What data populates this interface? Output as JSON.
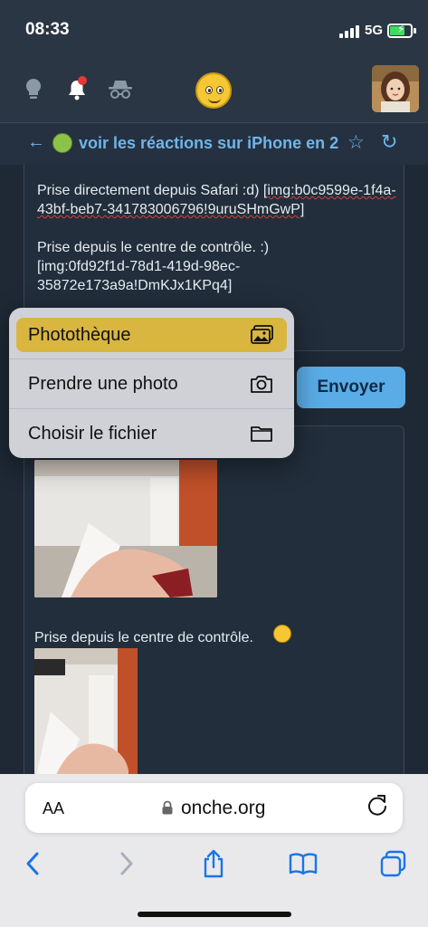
{
  "status_bar": {
    "time": "08:33",
    "network": "5G"
  },
  "header": {
    "icons": [
      "lightbulb-icon",
      "bell-icon",
      "incognito-icon",
      "smiley-logo-icon"
    ],
    "has_notification": true
  },
  "topic": {
    "title": "voir les réactions sur iPhone en 2"
  },
  "editor": {
    "line1": "Prise directement depuis Safari :d) ",
    "token1": "[img:b0c9599e-1f4a-43bf-beb7-341783006796!9uruSHmGwP]",
    "line2": "Prise depuis le centre de contrôle. :)",
    "token2": "[img:0fd92f1d-78d1-419d-98ec-35872e173a9a!DmKJx1KPq4]"
  },
  "send_button": {
    "label": "Envoyer"
  },
  "upload_menu": {
    "items": [
      {
        "label": "Photothèque",
        "icon": "photo-library-icon",
        "selected": true
      },
      {
        "label": "Prendre une photo",
        "icon": "camera-icon",
        "selected": false
      },
      {
        "label": "Choisir le fichier",
        "icon": "folder-icon",
        "selected": false
      }
    ],
    "highlight_color": "#d8b640"
  },
  "preview": {
    "caption": "Prise depuis le centre de contrôle."
  },
  "browser": {
    "text_size": "AA",
    "url": "onche.org"
  },
  "colors": {
    "accent": "#6fb5ea",
    "button": "#5aace6",
    "background": "#1e2935"
  }
}
